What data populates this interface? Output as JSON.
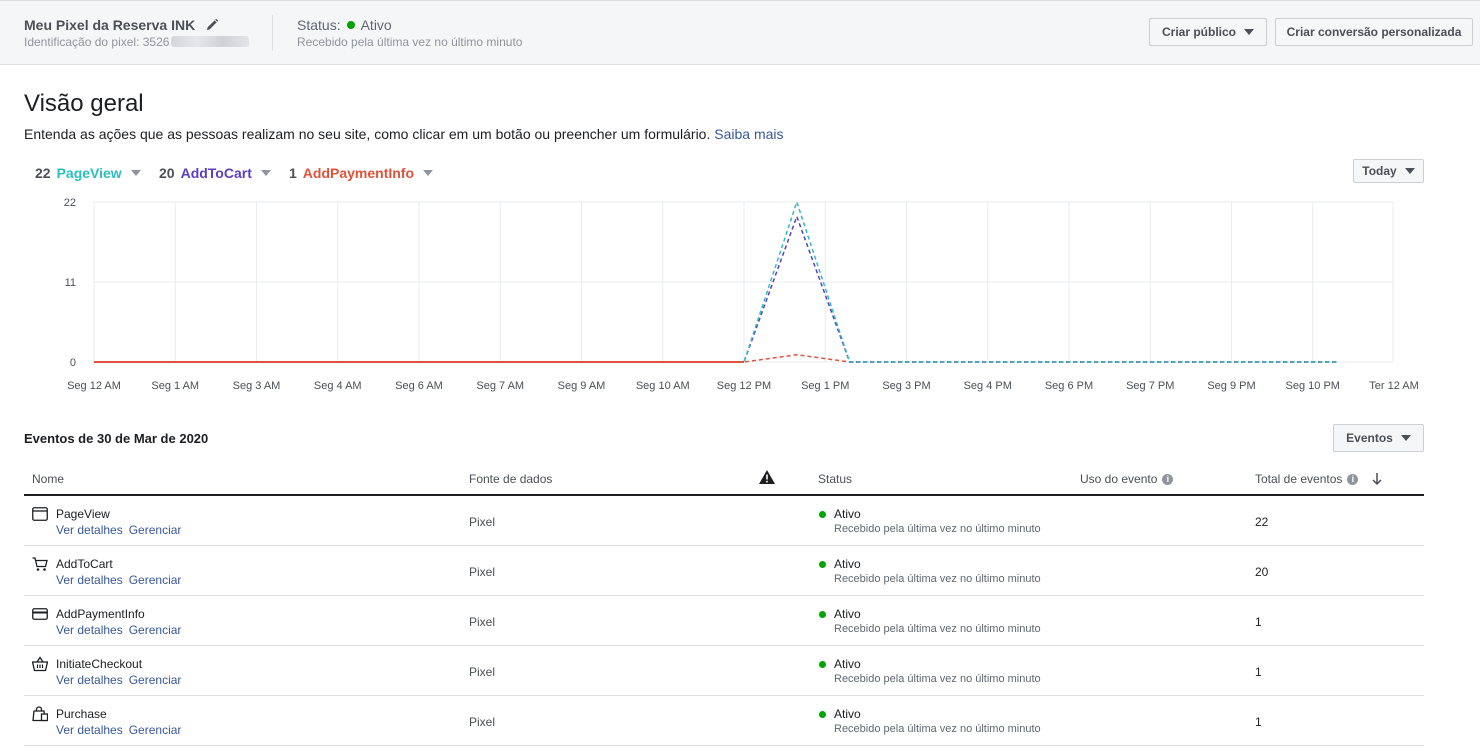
{
  "header": {
    "pixel_name": "Meu Pixel da Reserva INK",
    "pixel_id_label": "Identificação do pixel: 3526",
    "status_label": "Status:",
    "status_value": "Ativo",
    "status_sub": "Recebido pela última vez no último minuto",
    "btn_audience": "Criar público",
    "btn_conversion": "Criar conversão personalizada"
  },
  "overview": {
    "title": "Visão geral",
    "description": "Entenda as ações que as pessoas realizam no seu site, como clicar em um botão ou preencher um formulário.",
    "learn_more": "Saiba mais",
    "range_button": "Today"
  },
  "legend": [
    {
      "count": "22",
      "name": "PageView",
      "color": "#2bbfbf"
    },
    {
      "count": "20",
      "name": "AddToCart",
      "color": "#5b3fbf"
    },
    {
      "count": "1",
      "name": "AddPaymentInfo",
      "color": "#e0533a"
    }
  ],
  "chart_data": {
    "type": "line",
    "title": "",
    "xlabel": "",
    "ylabel": "",
    "ylim": [
      0,
      22
    ],
    "yticks": [
      "0",
      "11",
      "22"
    ],
    "x": [
      "Seg 12 AM",
      "Seg 1 AM",
      "Seg 3 AM",
      "Seg 4 AM",
      "Seg 6 AM",
      "Seg 7 AM",
      "Seg 9 AM",
      "Seg 10 AM",
      "Seg 12 PM",
      "Seg 1 PM",
      "Seg 3 PM",
      "Seg 4 PM",
      "Seg 6 PM",
      "Seg 7 PM",
      "Seg 9 PM",
      "Seg 10 PM",
      "Ter 12 AM"
    ],
    "grid": true,
    "series": [
      {
        "name": "PageView",
        "color": "#2bbfbf",
        "points": [
          [
            0,
            0
          ],
          [
            8,
            0
          ],
          [
            8.65,
            22
          ],
          [
            9.3,
            0
          ],
          [
            15.3,
            0
          ]
        ]
      },
      {
        "name": "AddToCart",
        "color": "#5b3fbf",
        "points": [
          [
            0,
            0
          ],
          [
            8,
            0
          ],
          [
            8.65,
            20
          ],
          [
            9.3,
            0
          ],
          [
            15.3,
            0
          ]
        ]
      },
      {
        "name": "AddPaymentInfo",
        "color": "#e0533a",
        "points": [
          [
            0,
            0
          ],
          [
            8,
            0
          ],
          [
            8.65,
            1
          ],
          [
            9.3,
            0
          ],
          [
            15.3,
            0
          ]
        ]
      }
    ]
  },
  "events": {
    "title": "Eventos de 30 de Mar de 2020",
    "filter_button": "Eventos",
    "columns": {
      "name": "Nome",
      "source": "Fonte de dados",
      "status": "Status",
      "usage": "Uso do evento",
      "total": "Total de eventos"
    },
    "link_details": "Ver detalhes",
    "link_manage": "Gerenciar",
    "rows": [
      {
        "name": "PageView",
        "icon": "browser-window-icon",
        "source": "Pixel",
        "status": "Ativo",
        "status_sub": "Recebido pela última vez no último minuto",
        "total": "22"
      },
      {
        "name": "AddToCart",
        "icon": "cart-icon",
        "source": "Pixel",
        "status": "Ativo",
        "status_sub": "Recebido pela última vez no último minuto",
        "total": "20"
      },
      {
        "name": "AddPaymentInfo",
        "icon": "credit-card-icon",
        "source": "Pixel",
        "status": "Ativo",
        "status_sub": "Recebido pela última vez no último minuto",
        "total": "1"
      },
      {
        "name": "InitiateCheckout",
        "icon": "basket-icon",
        "source": "Pixel",
        "status": "Ativo",
        "status_sub": "Recebido pela última vez no último minuto",
        "total": "1"
      },
      {
        "name": "Purchase",
        "icon": "shopping-bag-icon",
        "source": "Pixel",
        "status": "Ativo",
        "status_sub": "Recebido pela última vez no último minuto",
        "total": "1"
      }
    ]
  }
}
